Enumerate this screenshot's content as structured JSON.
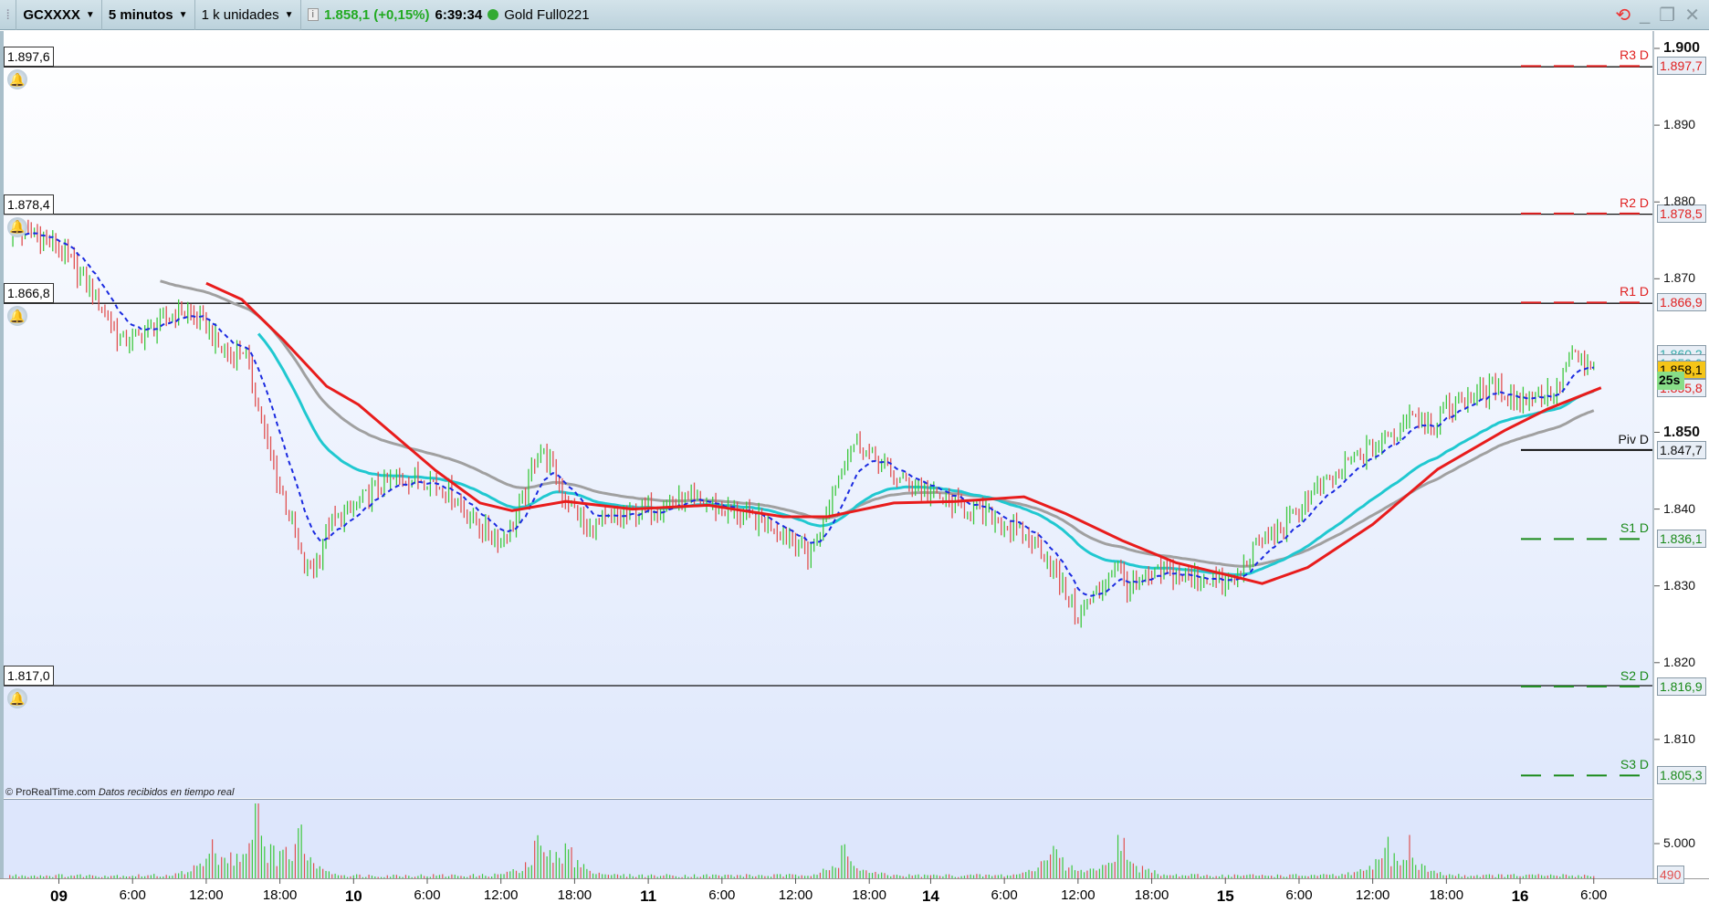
{
  "toolbar": {
    "symbol": "GCXXXX",
    "timeframe": "5 minutos",
    "units": "1 k unidades",
    "price": "1.858,1 (+0,15%)",
    "time": "6:39:34",
    "instrument": "Gold Full0221",
    "up_color": "#22aa22"
  },
  "credit": {
    "brand": "© ProRealTime.com",
    "status": "Datos recibidos en tiempo real"
  },
  "alert_levels": [
    {
      "label": "1.897,6",
      "value": 1897.6
    },
    {
      "label": "1.878,4",
      "value": 1878.4
    },
    {
      "label": "1.866,8",
      "value": 1866.8
    },
    {
      "label": "1.817,0",
      "value": 1817.0
    }
  ],
  "pivots": [
    {
      "name": "R3 D",
      "tag": "1.897,7",
      "value": 1897.7,
      "color": "#e02020"
    },
    {
      "name": "R2 D",
      "tag": "1.878,5",
      "value": 1878.5,
      "color": "#e02020"
    },
    {
      "name": "R1 D",
      "tag": "1.866,9",
      "value": 1866.9,
      "color": "#e02020"
    },
    {
      "name": "Piv D",
      "tag": "1.847,7",
      "value": 1847.7,
      "color": "#111111"
    },
    {
      "name": "S1 D",
      "tag": "1.836,1",
      "value": 1836.1,
      "color": "#1a8a1a"
    },
    {
      "name": "S2 D",
      "tag": "1.816,9",
      "value": 1816.9,
      "color": "#1a8a1a"
    },
    {
      "name": "S3 D",
      "tag": "1.805,3",
      "value": 1805.3,
      "color": "#1a8a1a"
    }
  ],
  "right_tags": {
    "cyan1": "1.860,2",
    "cyan2": "1.859,0",
    "last": "1.858,1",
    "countdown": "25s",
    "red": "1.855,8",
    "volume_last": "490"
  },
  "chart_data": {
    "type": "line",
    "title": "GCXXXX 5 minutos",
    "xlabel": "",
    "ylabel": "",
    "ylim": [
      1800,
      1902
    ],
    "y_ticks": [
      {
        "label": "1.900",
        "value": 1900,
        "bold": true
      },
      {
        "label": "1.890",
        "value": 1890
      },
      {
        "label": "1.880",
        "value": 1880
      },
      {
        "label": "1.870",
        "value": 1870
      },
      {
        "label": "1.850",
        "value": 1850,
        "bold": true
      },
      {
        "label": "1.840",
        "value": 1840
      },
      {
        "label": "1.830",
        "value": 1830
      },
      {
        "label": "1.820",
        "value": 1820
      },
      {
        "label": "1.810",
        "value": 1810
      }
    ],
    "x_ticks": [
      {
        "label": "09",
        "t": 0,
        "bold": true
      },
      {
        "label": "6:00",
        "t": 6
      },
      {
        "label": "12:00",
        "t": 12
      },
      {
        "label": "18:00",
        "t": 18
      },
      {
        "label": "10",
        "t": 24,
        "bold": true
      },
      {
        "label": "6:00",
        "t": 30
      },
      {
        "label": "12:00",
        "t": 36
      },
      {
        "label": "18:00",
        "t": 42
      },
      {
        "label": "11",
        "t": 48,
        "bold": true
      },
      {
        "label": "6:00",
        "t": 54
      },
      {
        "label": "12:00",
        "t": 60
      },
      {
        "label": "18:00",
        "t": 66
      },
      {
        "label": "14",
        "t": 71,
        "bold": true
      },
      {
        "label": "6:00",
        "t": 77
      },
      {
        "label": "12:00",
        "t": 83
      },
      {
        "label": "18:00",
        "t": 89
      },
      {
        "label": "15",
        "t": 95,
        "bold": true
      },
      {
        "label": "6:00",
        "t": 101
      },
      {
        "label": "12:00",
        "t": 107
      },
      {
        "label": "18:00",
        "t": 113
      },
      {
        "label": "16",
        "t": 119,
        "bold": true
      },
      {
        "label": "6:00",
        "t": 125
      }
    ],
    "series": [
      {
        "name": "Price",
        "color": "#2a2",
        "points": [
          [
            -4,
            1876
          ],
          [
            -2,
            1876
          ],
          [
            0,
            1874
          ],
          [
            2,
            1870
          ],
          [
            4,
            1865
          ],
          [
            5,
            1862
          ],
          [
            6,
            1862
          ],
          [
            8,
            1864
          ],
          [
            10,
            1866
          ],
          [
            12,
            1864
          ],
          [
            13,
            1861
          ],
          [
            14,
            1860
          ],
          [
            15,
            1861
          ],
          [
            16,
            1855
          ],
          [
            17,
            1848
          ],
          [
            18,
            1843
          ],
          [
            19,
            1838
          ],
          [
            20,
            1832
          ],
          [
            21,
            1833
          ],
          [
            22,
            1838
          ],
          [
            23,
            1839
          ],
          [
            24,
            1840
          ],
          [
            26,
            1843
          ],
          [
            28,
            1844
          ],
          [
            30,
            1844
          ],
          [
            32,
            1842
          ],
          [
            34,
            1838
          ],
          [
            36,
            1836
          ],
          [
            37,
            1838
          ],
          [
            38,
            1842
          ],
          [
            39,
            1848
          ],
          [
            40,
            1846
          ],
          [
            41,
            1842
          ],
          [
            42,
            1840
          ],
          [
            43,
            1837
          ],
          [
            44,
            1838
          ],
          [
            46,
            1839
          ],
          [
            48,
            1840
          ],
          [
            50,
            1841
          ],
          [
            52,
            1841
          ],
          [
            54,
            1840
          ],
          [
            56,
            1839
          ],
          [
            58,
            1838
          ],
          [
            60,
            1836
          ],
          [
            61,
            1834
          ],
          [
            62,
            1837
          ],
          [
            63,
            1842
          ],
          [
            64,
            1847
          ],
          [
            65,
            1849
          ],
          [
            66,
            1847
          ],
          [
            67,
            1846
          ],
          [
            68,
            1844
          ],
          [
            70,
            1843
          ],
          [
            71,
            1842
          ],
          [
            72,
            1841
          ],
          [
            74,
            1840
          ],
          [
            76,
            1839
          ],
          [
            78,
            1837
          ],
          [
            80,
            1835
          ],
          [
            81,
            1832
          ],
          [
            82,
            1829
          ],
          [
            83,
            1826
          ],
          [
            84,
            1828
          ],
          [
            85,
            1830
          ],
          [
            86,
            1833
          ],
          [
            87,
            1830
          ],
          [
            88,
            1830
          ],
          [
            89,
            1831
          ],
          [
            90,
            1832
          ],
          [
            92,
            1831
          ],
          [
            94,
            1831
          ],
          [
            95,
            1830
          ],
          [
            96,
            1831
          ],
          [
            97,
            1834
          ],
          [
            98,
            1836
          ],
          [
            99,
            1837
          ],
          [
            100,
            1838
          ],
          [
            101,
            1840
          ],
          [
            102,
            1842
          ],
          [
            103,
            1843
          ],
          [
            104,
            1844
          ],
          [
            105,
            1846
          ],
          [
            106,
            1847
          ],
          [
            107,
            1848
          ],
          [
            108,
            1849
          ],
          [
            109,
            1850
          ],
          [
            110,
            1853
          ],
          [
            111,
            1852
          ],
          [
            112,
            1851
          ],
          [
            113,
            1853
          ],
          [
            114,
            1854
          ],
          [
            115,
            1855
          ],
          [
            116,
            1855
          ],
          [
            117,
            1856
          ],
          [
            118,
            1855
          ],
          [
            119,
            1854
          ],
          [
            120,
            1855
          ],
          [
            121,
            1855
          ],
          [
            122,
            1855
          ],
          [
            123,
            1860
          ],
          [
            124,
            1859
          ],
          [
            125,
            1858.1
          ]
        ]
      },
      {
        "name": "Long MA",
        "color": "#e81c1c",
        "points": [
          [
            12,
            1869.4
          ],
          [
            14.9,
            1867.3
          ],
          [
            18.3,
            1862
          ],
          [
            21.8,
            1856
          ],
          [
            24.4,
            1853.6
          ],
          [
            30.7,
            1845
          ],
          [
            34.3,
            1840.8
          ],
          [
            36.9,
            1839.8
          ],
          [
            41.3,
            1841
          ],
          [
            46.7,
            1840
          ],
          [
            52.9,
            1840.5
          ],
          [
            59,
            1839
          ],
          [
            62.6,
            1839
          ],
          [
            68,
            1840.8
          ],
          [
            73,
            1841
          ],
          [
            78.6,
            1841.6
          ],
          [
            82,
            1839.4
          ],
          [
            86.6,
            1835.9
          ],
          [
            91,
            1833
          ],
          [
            95.5,
            1831.3
          ],
          [
            98,
            1830.3
          ],
          [
            101.7,
            1832.4
          ],
          [
            107,
            1838
          ],
          [
            112.3,
            1845.2
          ],
          [
            117.7,
            1850.2
          ],
          [
            121.2,
            1853
          ],
          [
            125.6,
            1855.8
          ]
        ]
      }
    ],
    "volume": {
      "axis_label": "5.000",
      "axis_value": 5000,
      "last": 490,
      "peaks": [
        [
          16,
          10000
        ],
        [
          19.5,
          6000
        ],
        [
          12.5,
          4500
        ],
        [
          39,
          4000
        ],
        [
          41.5,
          5000
        ],
        [
          64,
          4000
        ],
        [
          81,
          4800
        ],
        [
          86.5,
          5800
        ],
        [
          108,
          4500
        ],
        [
          110,
          3800
        ]
      ]
    }
  }
}
